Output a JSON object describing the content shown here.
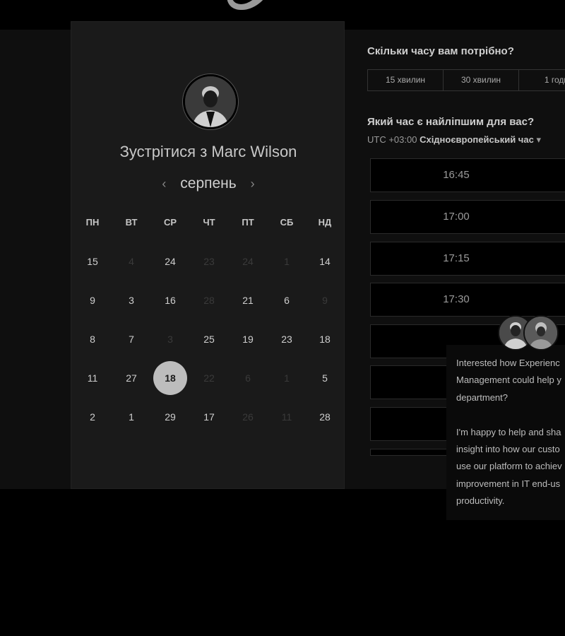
{
  "booking": {
    "meet_title": "Зустрітися з Marc Wilson",
    "month": "серпень",
    "prev_icon": "‹",
    "next_icon": "›",
    "weekdays": [
      "ПН",
      "ВТ",
      "СР",
      "ЧТ",
      "ПТ",
      "СБ",
      "НД"
    ],
    "weeks": [
      [
        "15",
        "4",
        "24",
        "23",
        "24",
        "1",
        "14"
      ],
      [
        "9",
        "3",
        "16",
        "28",
        "21",
        "6",
        "9"
      ],
      [
        "8",
        "7",
        "3",
        "25",
        "19",
        "23",
        "18"
      ],
      [
        "11",
        "27",
        "18",
        "22",
        "6",
        "1",
        "5"
      ],
      [
        "2",
        "1",
        "29",
        "17",
        "26",
        "11",
        "28"
      ]
    ],
    "selected_day": "18"
  },
  "duration": {
    "question": "Скільки часу вам потрібно?",
    "options": [
      "15 хвилин",
      "30 хвилин",
      "1 годи"
    ]
  },
  "time": {
    "question": "Який час є найліпшим для вас?",
    "tz_prefix": "UTC +03:00",
    "tz_name": "Східноєвропейський час",
    "tz_caret": "▾",
    "slots": [
      "16:45",
      "17:00",
      "17:15",
      "17:30"
    ]
  },
  "chat": {
    "message": "Interested how Experienc\nManagement could help y\ndepartment?\n\nI'm happy to help and sha\ninsight into how our custo\nuse our platform to achiev\nimprovement in IT end-us\nproductivity."
  }
}
